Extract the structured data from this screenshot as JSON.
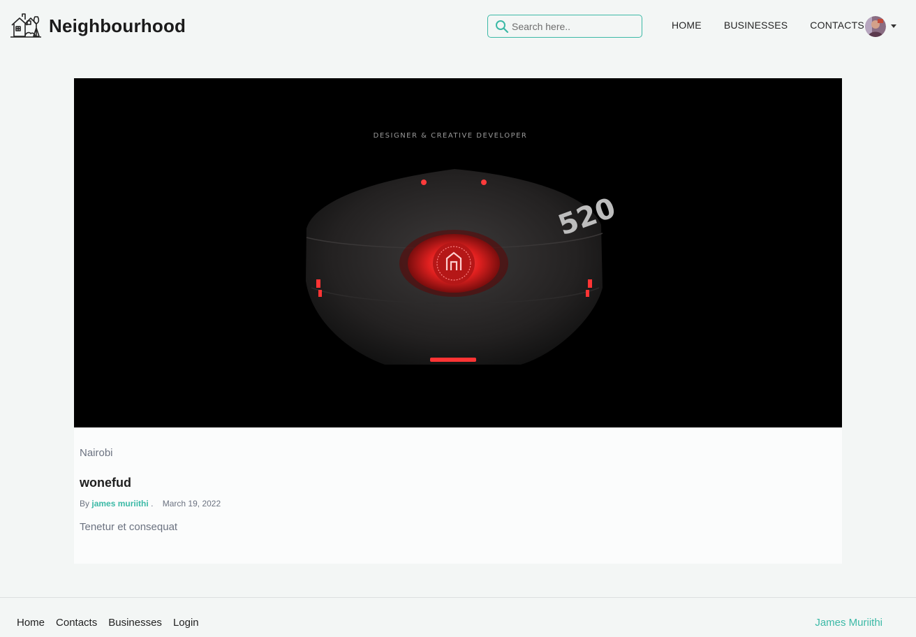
{
  "brand": {
    "name": "Neighbourhood"
  },
  "search": {
    "placeholder": "Search here.."
  },
  "nav": {
    "items": [
      {
        "label": "HOME"
      },
      {
        "label": "BUSINESSES"
      },
      {
        "label": "CONTACTS"
      }
    ]
  },
  "post": {
    "image_caption_text": "DESIGNER & CREATIVE DEVELOPER",
    "image_badge_text": "520",
    "location": "Nairobi",
    "title": "wonefud",
    "by_label": "By",
    "author": "james muriithi",
    "separator": ".",
    "date": "March 19, 2022",
    "excerpt": "Tenetur et consequat"
  },
  "footer": {
    "links": [
      {
        "label": "Home"
      },
      {
        "label": "Contacts"
      },
      {
        "label": "Businesses"
      },
      {
        "label": "Login"
      }
    ],
    "credit": "James Muriithi"
  },
  "colors": {
    "accent": "#3bb9a6",
    "background": "#f3f6f5",
    "card": "#fbfcfc"
  },
  "icons": {
    "logo": "house-tree-icon",
    "search": "search-icon",
    "avatar": "user-avatar",
    "caret": "caret-down-icon"
  }
}
